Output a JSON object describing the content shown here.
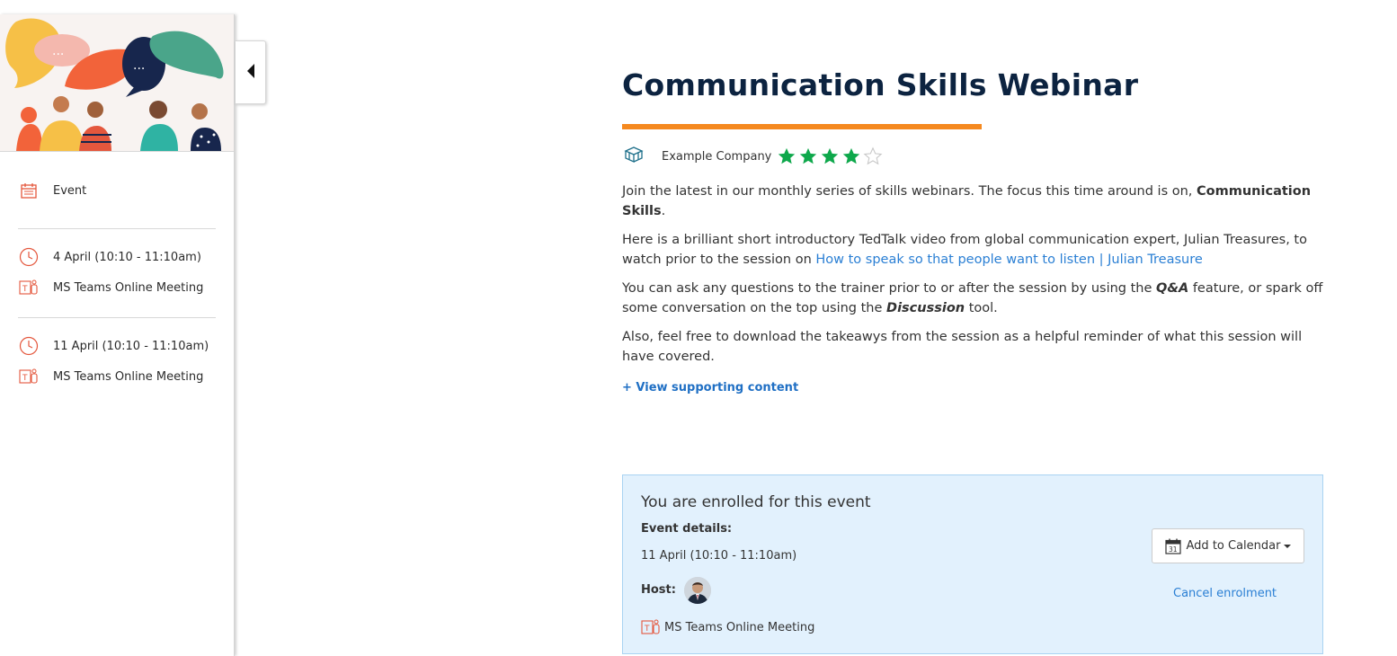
{
  "sidebar": {
    "event_label": "Event",
    "sessions": [
      {
        "date": "4 April (10:10 - 11:10am)",
        "location": "MS Teams Online Meeting"
      },
      {
        "date": "11 April (10:10 - 11:10am)",
        "location": "MS Teams Online Meeting"
      }
    ]
  },
  "main": {
    "title": "Communication Skills Webinar",
    "company": "Example Company",
    "rating": {
      "value": 4,
      "max": 5
    },
    "description": {
      "p1_text": "Join the latest in our monthly series of skills webinars. The focus this time around is on, ",
      "p1_bold": "Communication Skills",
      "p1_end": ".",
      "p2_text": "Here is a brilliant short introductory TedTalk video from global communication expert, Julian Treasures, to watch prior to the session on ",
      "p2_link": "How to speak so that people want to listen | Julian Treasure",
      "p3_a": "You can ask any questions to the trainer prior to or after the session by using the ",
      "p3_qa": "Q&A",
      "p3_b": " feature, or spark off some conversation on the top using the ",
      "p3_disc": "Discussion",
      "p3_c": " tool.",
      "p4": "Also, feel free to download the takeawys from the session as a helpful reminder of what this session will have covered."
    },
    "view_supporting": "+ View supporting content"
  },
  "enrolment": {
    "title": "You are enrolled for this event",
    "details_label": "Event details:",
    "date": "11 April (10:10 - 11:10am)",
    "host_label": "Host:",
    "location": "MS Teams Online Meeting",
    "calendar_button": "Add to Calendar",
    "calendar_day": "31",
    "cancel_link": "Cancel enrolment"
  },
  "colors": {
    "title": "#0c2340",
    "accent_rule": "#f5891f",
    "star": "#0ea84b",
    "link": "#2a7fd4",
    "enrol_bg": "#e2f1fd",
    "icon_red": "#e4573d"
  }
}
